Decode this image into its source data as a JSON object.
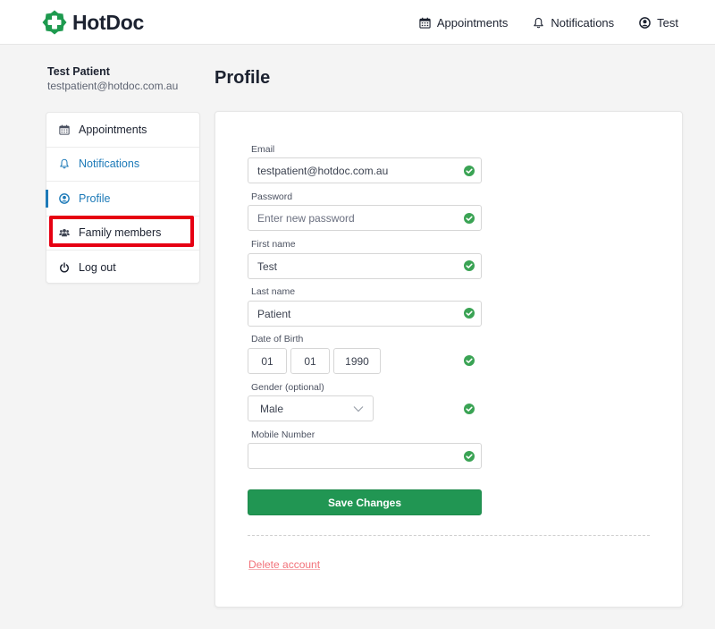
{
  "header": {
    "brand": "HotDoc",
    "nav": [
      {
        "label": "Appointments",
        "icon": "calendar-icon"
      },
      {
        "label": "Notifications",
        "icon": "bell-icon"
      },
      {
        "label": "Test",
        "icon": "user-circle-icon"
      }
    ]
  },
  "user": {
    "name": "Test Patient",
    "email": "testpatient@hotdoc.com.au"
  },
  "page": {
    "title": "Profile"
  },
  "sidebar": {
    "items": [
      {
        "label": "Appointments",
        "icon": "calendar-icon",
        "state": "default"
      },
      {
        "label": "Notifications",
        "icon": "bell-icon",
        "state": "link"
      },
      {
        "label": "Profile",
        "icon": "user-circle-icon",
        "state": "active"
      },
      {
        "label": "Family members",
        "icon": "users-icon",
        "state": "highlighted"
      },
      {
        "label": "Log out",
        "icon": "power-icon",
        "state": "default"
      }
    ]
  },
  "form": {
    "email": {
      "label": "Email",
      "value": "testpatient@hotdoc.com.au",
      "valid": true
    },
    "password": {
      "label": "Password",
      "placeholder": "Enter new password",
      "value": "",
      "valid": true
    },
    "first_name": {
      "label": "First name",
      "value": "Test",
      "valid": true
    },
    "last_name": {
      "label": "Last name",
      "value": "Patient",
      "valid": true
    },
    "dob": {
      "label": "Date of Birth",
      "day": "01",
      "month": "01",
      "year": "1990",
      "valid": true
    },
    "gender": {
      "label": "Gender (optional)",
      "selected": "Male",
      "valid": true
    },
    "mobile": {
      "label": "Mobile Number",
      "value": "",
      "valid": true
    },
    "save_label": "Save Changes",
    "delete_label": "Delete account"
  },
  "colors": {
    "brand_green": "#219653",
    "link_blue": "#1d7ab8",
    "valid_green": "#3aa354",
    "danger": "#f2727a",
    "highlight_red": "#e60012"
  }
}
